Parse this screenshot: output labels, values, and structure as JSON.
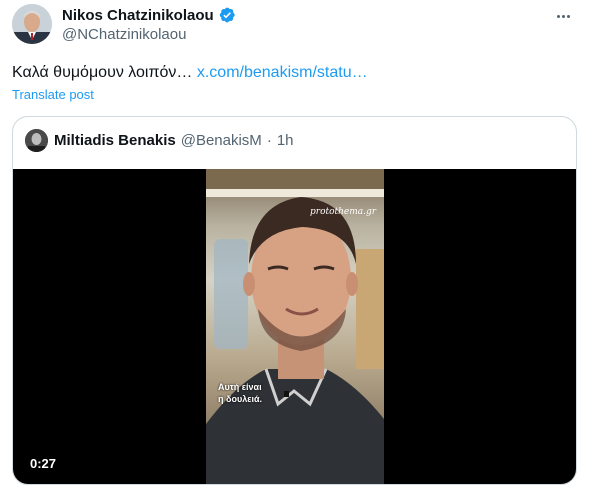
{
  "post": {
    "author_name": "Nikos Chatzinikolaou",
    "author_handle": "@NChatzinikolaou",
    "text": "Καλά θυμόμουν λοιπόν… ",
    "link_text": "x.com/benakism/statu…",
    "translate_label": "Translate post"
  },
  "quoted": {
    "author_name": "Miltiadis Benakis",
    "author_handle": "@BenakisM",
    "separator": "·",
    "time": "1h",
    "video": {
      "watermark": "protothema.gr",
      "subtitle_line1": "Αυτή είναι",
      "subtitle_line2": "η δουλειά.",
      "duration": "0:27"
    }
  },
  "colors": {
    "accent": "#1d9bf0",
    "text_primary": "#0f1419",
    "text_secondary": "#536471",
    "border": "#cfd9de",
    "video_bg": "#000000"
  },
  "icons": [
    "verified-badge-icon",
    "more-options-icon"
  ]
}
